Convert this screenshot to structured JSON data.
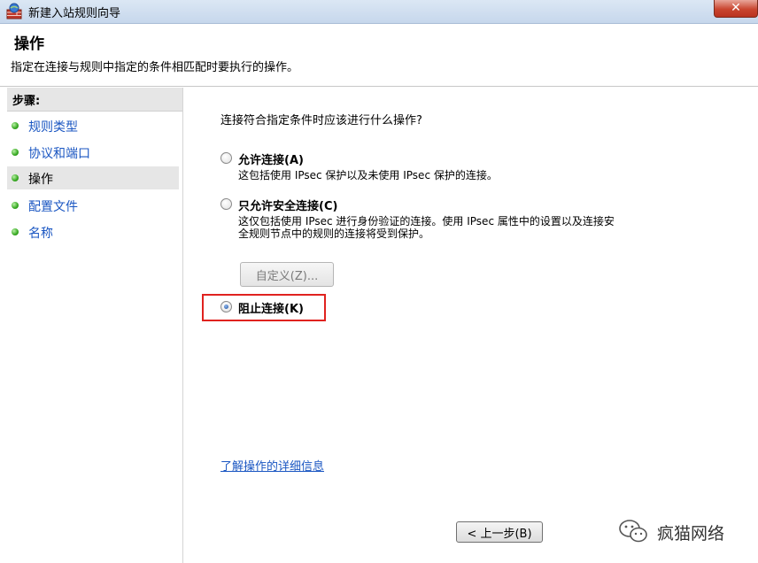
{
  "window": {
    "title": "新建入站规则向导",
    "close_label": "✕"
  },
  "header": {
    "title": "操作",
    "description": "指定在连接与规则中指定的条件相匹配时要执行的操作。"
  },
  "sidebar": {
    "steps_label": "步骤:",
    "items": [
      {
        "label": "规则类型"
      },
      {
        "label": "协议和端口"
      },
      {
        "label": "操作"
      },
      {
        "label": "配置文件"
      },
      {
        "label": "名称"
      }
    ],
    "active_index": 2
  },
  "main": {
    "question": "连接符合指定条件时应该进行什么操作?",
    "options": [
      {
        "label": "允许连接(A)",
        "description": "这包括使用 IPsec 保护以及未使用 IPsec 保护的连接。",
        "checked": false
      },
      {
        "label": "只允许安全连接(C)",
        "description_line1": "这仅包括使用 IPsec 进行身份验证的连接。使用 IPsec 属性中的设置以及连接安",
        "description_line2": "全规则节点中的规则的连接将受到保护。",
        "checked": false
      },
      {
        "label": "阻止连接(K)",
        "checked": true
      }
    ],
    "customize_label": "自定义(Z)...",
    "learn_more": "了解操作的详细信息"
  },
  "footer": {
    "back_label": "< 上一步(B)"
  },
  "watermark": {
    "text": "疯猫网络"
  },
  "colors": {
    "link": "#1a56c2",
    "highlight": "#e0221f",
    "dot": "#35a820"
  }
}
